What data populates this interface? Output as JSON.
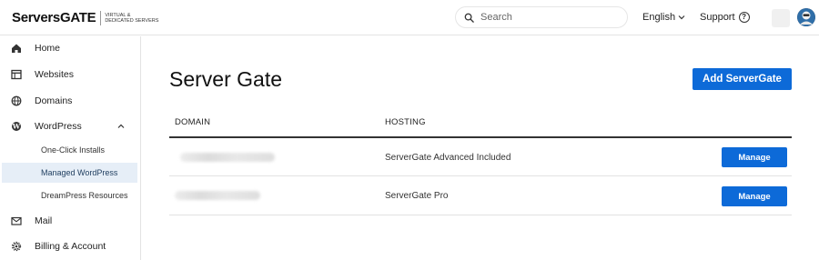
{
  "header": {
    "logo_text": "ServersGATE",
    "logo_tagline": "VIRTUAL & DEDICATED SERVERS",
    "search_placeholder": "Search",
    "language": "English",
    "support": "Support",
    "support_icon": "?"
  },
  "sidebar": {
    "items": [
      {
        "label": "Home",
        "icon": "home-icon"
      },
      {
        "label": "Websites",
        "icon": "browser-icon"
      },
      {
        "label": "Domains",
        "icon": "globe-icon"
      },
      {
        "label": "WordPress",
        "icon": "wordpress-icon"
      },
      {
        "label": "Mail",
        "icon": "mail-icon"
      },
      {
        "label": "Billing & Account",
        "icon": "gear-icon"
      }
    ],
    "wordpress_sub": [
      {
        "label": "One-Click Installs",
        "active": false
      },
      {
        "label": "Managed WordPress",
        "active": true
      },
      {
        "label": "DreamPress Resources",
        "active": false
      }
    ]
  },
  "main": {
    "title": "Server Gate",
    "add_button": "Add ServerGate",
    "columns": [
      "DOMAIN",
      "HOSTING"
    ],
    "rows": [
      {
        "hosting": "ServerGate Advanced Included",
        "action": "Manage"
      },
      {
        "hosting": "ServerGate Pro",
        "action": "Manage"
      }
    ]
  },
  "colors": {
    "accent": "#0d6ad8",
    "active_bg": "#e6eef7"
  }
}
